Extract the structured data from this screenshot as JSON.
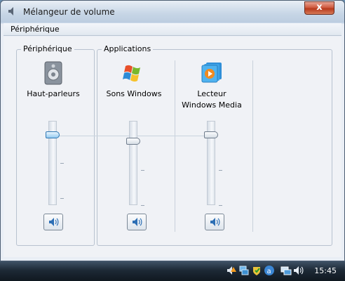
{
  "window": {
    "title": "Mélangeur de volume",
    "close_label": "x"
  },
  "menu": {
    "device_menu_label": "Périphérique"
  },
  "groups": {
    "device_label": "Périphérique",
    "applications_label": "Applications"
  },
  "channels": [
    {
      "label": "Haut-parleurs",
      "icon": "speaker-icon",
      "level": 0.95,
      "focused": true
    },
    {
      "label": "Sons Windows",
      "icon": "windows-logo-icon",
      "level": 0.92,
      "focused": false
    },
    {
      "label": "Lecteur Windows Media",
      "icon": "media-player-icon",
      "level": 0.95,
      "focused": false
    }
  ],
  "taskbar": {
    "clock": "15:45",
    "tray_icons": [
      "volume-warning-icon",
      "network-icon",
      "security-icon",
      "accessibility-icon",
      "network-connections-icon",
      "volume-icon"
    ]
  },
  "colors": {
    "accent": "#3a84c8",
    "close_button": "#c74a2b",
    "taskbar": "#1d2936"
  }
}
